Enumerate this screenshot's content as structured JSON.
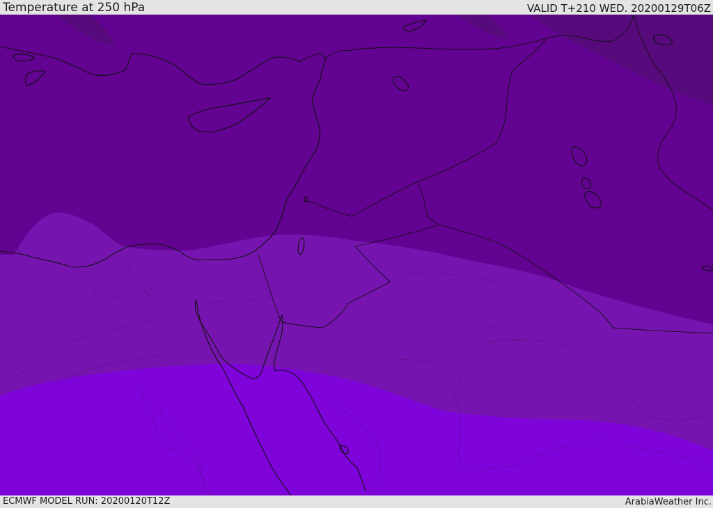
{
  "header": {
    "title": "Temperature at 250 hPa",
    "valid": "VALID T+210 WED. 20200129T06Z"
  },
  "footer": {
    "model_run": "ECMWF MODEL RUN: 20200120T12Z",
    "credit": "ArabiaWeather Inc."
  },
  "map": {
    "colors": {
      "band_coldest": "#560a7c",
      "band_cold": "#620391",
      "band_mid": "#7614b0",
      "band_warm": "#7e04da"
    }
  }
}
